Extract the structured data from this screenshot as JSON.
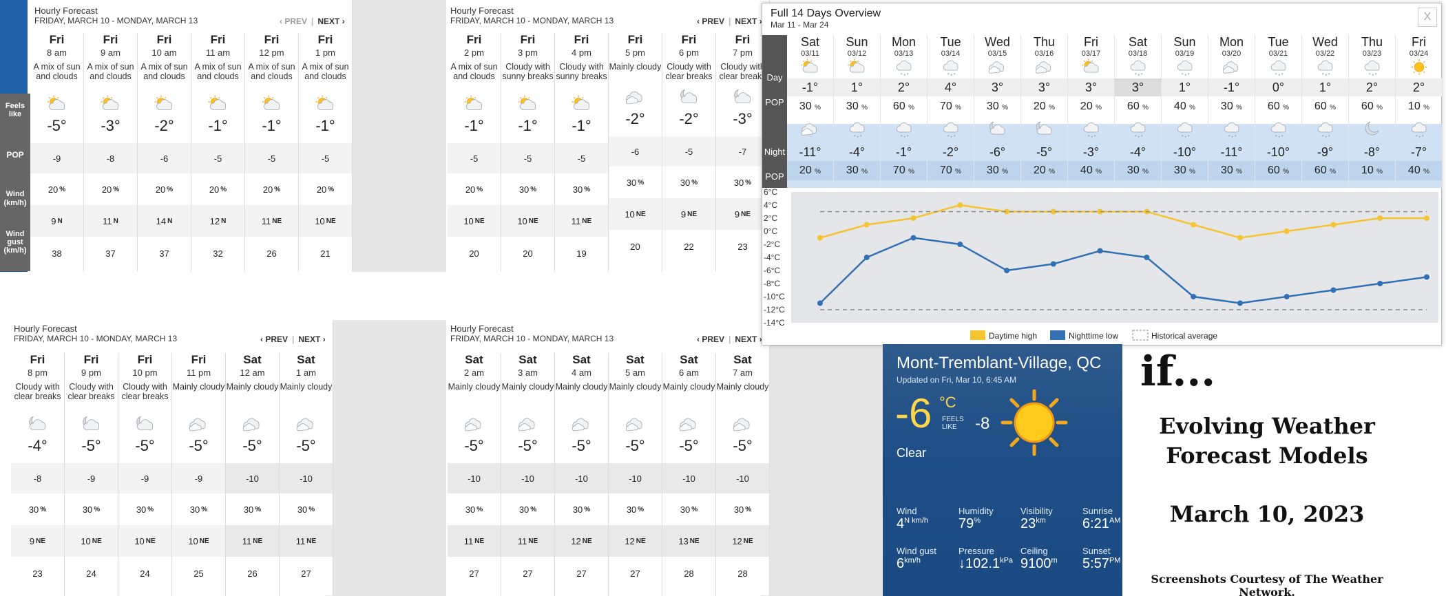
{
  "hourly_header": {
    "title": "Hourly Forecast",
    "range": "FRIDAY, MARCH 10 - MONDAY, MARCH 13",
    "prev": "‹ PREV",
    "next": "NEXT ›"
  },
  "row_labels": {
    "feels": "Feels like",
    "pop": "POP",
    "wind": "Wind (km/h)",
    "gust": "Wind gust (km/h)"
  },
  "panels": [
    {
      "cols": [
        {
          "day": "Fri",
          "time": "8 am",
          "cond": "A mix of sun and clouds",
          "icon": "sun-cloud-icon",
          "temp": "-5°",
          "feels": "-9",
          "pop": "20",
          "wind": "9",
          "dir": "N",
          "gust": "38"
        },
        {
          "day": "Fri",
          "time": "9 am",
          "cond": "A mix of sun and clouds",
          "icon": "sun-cloud-icon",
          "temp": "-3°",
          "feels": "-8",
          "pop": "20",
          "wind": "11",
          "dir": "N",
          "gust": "37"
        },
        {
          "day": "Fri",
          "time": "10 am",
          "cond": "A mix of sun and clouds",
          "icon": "sun-cloud-icon",
          "temp": "-2°",
          "feels": "-6",
          "pop": "20",
          "wind": "14",
          "dir": "N",
          "gust": "37"
        },
        {
          "day": "Fri",
          "time": "11 am",
          "cond": "A mix of sun and clouds",
          "icon": "sun-cloud-icon",
          "temp": "-1°",
          "feels": "-5",
          "pop": "20",
          "wind": "12",
          "dir": "N",
          "gust": "32"
        },
        {
          "day": "Fri",
          "time": "12 pm",
          "cond": "A mix of sun and clouds",
          "icon": "sun-cloud-icon",
          "temp": "-1°",
          "feels": "-5",
          "pop": "20",
          "wind": "11",
          "dir": "NE",
          "gust": "26"
        },
        {
          "day": "Fri",
          "time": "1 pm",
          "cond": "A mix of sun and clouds",
          "icon": "sun-cloud-icon",
          "temp": "-1°",
          "feels": "-5",
          "pop": "20",
          "wind": "10",
          "dir": "NE",
          "gust": "21"
        }
      ]
    },
    {
      "cols": [
        {
          "day": "Fri",
          "time": "2 pm",
          "cond": "A mix of sun and clouds",
          "icon": "sun-cloud-icon",
          "temp": "-1°",
          "feels": "-5",
          "pop": "20",
          "wind": "10",
          "dir": "NE",
          "gust": "20"
        },
        {
          "day": "Fri",
          "time": "3 pm",
          "cond": "Cloudy with sunny breaks",
          "icon": "sun-cloud-icon",
          "temp": "-1°",
          "feels": "-5",
          "pop": "30",
          "wind": "10",
          "dir": "NE",
          "gust": "20"
        },
        {
          "day": "Fri",
          "time": "4 pm",
          "cond": "Cloudy with sunny breaks",
          "icon": "sun-cloud-icon",
          "temp": "-1°",
          "feels": "-5",
          "pop": "30",
          "wind": "11",
          "dir": "NE",
          "gust": "19"
        },
        {
          "day": "Fri",
          "time": "5 pm",
          "cond": "Mainly cloudy",
          "icon": "cloud-icon",
          "temp": "-2°",
          "feels": "-6",
          "pop": "30",
          "wind": "10",
          "dir": "NE",
          "gust": "20"
        },
        {
          "day": "Fri",
          "time": "6 pm",
          "cond": "Cloudy with clear breaks",
          "icon": "moon-cloud-icon",
          "temp": "-2°",
          "feels": "-5",
          "pop": "30",
          "wind": "9",
          "dir": "NE",
          "gust": "22"
        },
        {
          "day": "Fri",
          "time": "7 pm",
          "cond": "Cloudy with clear breaks",
          "icon": "moon-cloud-icon",
          "temp": "-3°",
          "feels": "-7",
          "pop": "30",
          "wind": "9",
          "dir": "NE",
          "gust": "23"
        }
      ]
    },
    {
      "cols": [
        {
          "day": "Fri",
          "time": "8 pm",
          "cond": "Cloudy with clear breaks",
          "icon": "moon-cloud-icon",
          "temp": "-4°",
          "feels": "-8",
          "pop": "30",
          "wind": "9",
          "dir": "NE",
          "gust": "23"
        },
        {
          "day": "Fri",
          "time": "9 pm",
          "cond": "Cloudy with clear breaks",
          "icon": "moon-cloud-icon",
          "temp": "-5°",
          "feels": "-9",
          "pop": "30",
          "wind": "10",
          "dir": "NE",
          "gust": "24"
        },
        {
          "day": "Fri",
          "time": "10 pm",
          "cond": "Cloudy with clear breaks",
          "icon": "moon-cloud-icon",
          "temp": "-5°",
          "feels": "-9",
          "pop": "30",
          "wind": "10",
          "dir": "NE",
          "gust": "24"
        },
        {
          "day": "Fri",
          "time": "11 pm",
          "cond": "Mainly cloudy",
          "icon": "cloud-icon",
          "temp": "-5°",
          "feels": "-9",
          "pop": "30",
          "wind": "10",
          "dir": "NE",
          "gust": "25"
        },
        {
          "day": "Sat",
          "time": "12 am",
          "cond": "Mainly cloudy",
          "icon": "cloud-icon",
          "temp": "-5°",
          "feels": "-10",
          "pop": "30",
          "wind": "11",
          "dir": "NE",
          "gust": "26"
        },
        {
          "day": "Sat",
          "time": "1 am",
          "cond": "Mainly cloudy",
          "icon": "cloud-icon",
          "temp": "-5°",
          "feels": "-10",
          "pop": "30",
          "wind": "11",
          "dir": "NE",
          "gust": "27"
        }
      ]
    },
    {
      "cols": [
        {
          "day": "Sat",
          "time": "2 am",
          "cond": "Mainly cloudy",
          "icon": "cloud-icon",
          "temp": "-5°",
          "feels": "-10",
          "pop": "30",
          "wind": "11",
          "dir": "NE",
          "gust": "27"
        },
        {
          "day": "Sat",
          "time": "3 am",
          "cond": "Mainly cloudy",
          "icon": "cloud-icon",
          "temp": "-5°",
          "feels": "-10",
          "pop": "30",
          "wind": "11",
          "dir": "NE",
          "gust": "27"
        },
        {
          "day": "Sat",
          "time": "4 am",
          "cond": "Mainly cloudy",
          "icon": "cloud-icon",
          "temp": "-5°",
          "feels": "-10",
          "pop": "30",
          "wind": "12",
          "dir": "NE",
          "gust": "27"
        },
        {
          "day": "Sat",
          "time": "5 am",
          "cond": "Mainly cloudy",
          "icon": "cloud-icon",
          "temp": "-5°",
          "feels": "-10",
          "pop": "30",
          "wind": "12",
          "dir": "NE",
          "gust": "27"
        },
        {
          "day": "Sat",
          "time": "6 am",
          "cond": "Mainly cloudy",
          "icon": "cloud-icon",
          "temp": "-5°",
          "feels": "-10",
          "pop": "30",
          "wind": "13",
          "dir": "NE",
          "gust": "28"
        },
        {
          "day": "Sat",
          "time": "7 am",
          "cond": "Mainly cloudy",
          "icon": "cloud-icon",
          "temp": "-5°",
          "feels": "-10",
          "pop": "30",
          "wind": "12",
          "dir": "NE",
          "gust": "28"
        }
      ]
    }
  ],
  "overview": {
    "title": "Full 14 Days Overview",
    "range": "Mar 11 - Mar 24",
    "close": "X",
    "labels": {
      "day": "Day",
      "pop": "POP",
      "night": "Night"
    },
    "days": [
      {
        "dn": "Sat",
        "dd": "03/11",
        "icon": "sun-cloud-icon",
        "hi": "-1°",
        "dpop": "30",
        "nicon": "cloud-icon",
        "lo": "-11°",
        "npop": "20"
      },
      {
        "dn": "Sun",
        "dd": "03/12",
        "icon": "sun-cloud-icon",
        "hi": "1°",
        "dpop": "30",
        "nicon": "snow-cloud-icon",
        "lo": "-4°",
        "npop": "30"
      },
      {
        "dn": "Mon",
        "dd": "03/13",
        "icon": "snow-cloud-icon",
        "hi": "2°",
        "dpop": "60",
        "nicon": "snow-cloud-icon",
        "lo": "-1°",
        "npop": "70"
      },
      {
        "dn": "Tue",
        "dd": "03/14",
        "icon": "snow-cloud-icon",
        "hi": "4°",
        "dpop": "70",
        "nicon": "snow-cloud-icon",
        "lo": "-2°",
        "npop": "70"
      },
      {
        "dn": "Wed",
        "dd": "03/15",
        "icon": "cloud-icon",
        "hi": "3°",
        "dpop": "30",
        "nicon": "moon-cloud-icon",
        "lo": "-6°",
        "npop": "30"
      },
      {
        "dn": "Thu",
        "dd": "03/16",
        "icon": "cloud-icon",
        "hi": "3°",
        "dpop": "20",
        "nicon": "moon-cloud-icon",
        "lo": "-5°",
        "npop": "20"
      },
      {
        "dn": "Fri",
        "dd": "03/17",
        "icon": "sun-cloud-icon",
        "hi": "3°",
        "dpop": "20",
        "nicon": "snow-cloud-icon",
        "lo": "-3°",
        "npop": "40"
      },
      {
        "dn": "Sat",
        "dd": "03/18",
        "icon": "snow-cloud-icon",
        "hi": "3°",
        "dpop": "60",
        "nicon": "snow-cloud-icon",
        "lo": "-4°",
        "npop": "30"
      },
      {
        "dn": "Sun",
        "dd": "03/19",
        "icon": "snow-cloud-icon",
        "hi": "1°",
        "dpop": "40",
        "nicon": "snow-cloud-icon",
        "lo": "-10°",
        "npop": "30"
      },
      {
        "dn": "Mon",
        "dd": "03/20",
        "icon": "cloud-icon",
        "hi": "-1°",
        "dpop": "30",
        "nicon": "snow-cloud-icon",
        "lo": "-11°",
        "npop": "30"
      },
      {
        "dn": "Tue",
        "dd": "03/21",
        "icon": "snow-cloud-icon",
        "hi": "0°",
        "dpop": "60",
        "nicon": "snow-cloud-icon",
        "lo": "-10°",
        "npop": "60"
      },
      {
        "dn": "Wed",
        "dd": "03/22",
        "icon": "snow-cloud-icon",
        "hi": "1°",
        "dpop": "60",
        "nicon": "snow-cloud-icon",
        "lo": "-9°",
        "npop": "60"
      },
      {
        "dn": "Thu",
        "dd": "03/23",
        "icon": "snow-cloud-icon",
        "hi": "2°",
        "dpop": "60",
        "nicon": "moon-icon",
        "lo": "-8°",
        "npop": "10"
      },
      {
        "dn": "Fri",
        "dd": "03/24",
        "icon": "sun-icon",
        "hi": "2°",
        "dpop": "10",
        "nicon": "snow-cloud-icon",
        "lo": "-7°",
        "npop": "40"
      }
    ]
  },
  "chart_data": {
    "type": "line",
    "x": [
      "03/11",
      "03/12",
      "03/13",
      "03/14",
      "03/15",
      "03/16",
      "03/17",
      "03/18",
      "03/19",
      "03/20",
      "03/21",
      "03/22",
      "03/23",
      "03/24"
    ],
    "series": [
      {
        "name": "Daytime high",
        "color": "#f5c431",
        "values": [
          -1,
          1,
          2,
          4,
          3,
          3,
          3,
          3,
          1,
          -1,
          0,
          1,
          2,
          2
        ]
      },
      {
        "name": "Nighttime low",
        "color": "#3370b3",
        "values": [
          -11,
          -4,
          -1,
          -2,
          -6,
          -5,
          -3,
          -4,
          -10,
          -11,
          -10,
          -9,
          -8,
          -7
        ]
      },
      {
        "name": "Historical average",
        "color": "#888888",
        "dashed": true,
        "values": [
          3,
          3,
          3,
          3,
          3,
          3,
          3,
          3,
          3,
          3,
          3,
          3,
          3,
          3
        ]
      },
      {
        "name": "",
        "color": "#888888",
        "dashed": true,
        "values": [
          -12,
          -12,
          -12,
          -12,
          -12,
          -12,
          -12,
          -12,
          -12,
          -12,
          -12,
          -12,
          -12,
          -12
        ]
      }
    ],
    "ylim": [
      -14,
      6
    ],
    "yticks": [
      "6°C",
      "4°C",
      "2°C",
      "0°C",
      "-2°C",
      "-4°C",
      "-6°C",
      "-8°C",
      "-10°C",
      "-12°C",
      "-14°C"
    ],
    "legend": {
      "placement": "bottom",
      "items": [
        "Daytime high",
        "Nighttime low",
        "Historical average"
      ]
    }
  },
  "current": {
    "location": "Mont-Tremblant-Village, QC",
    "updated": "Updated on Fri, Mar 10, 6:45 AM",
    "temp": "-6",
    "unit": "°C",
    "feels_label": "FEELS LIKE",
    "feels": "-8",
    "condition": "Clear",
    "stats": [
      {
        "label": "Wind",
        "value": "4",
        "sup": "N km/h"
      },
      {
        "label": "Humidity",
        "value": "79",
        "sup": "%"
      },
      {
        "label": "Visibility",
        "value": "23",
        "sup": "km"
      },
      {
        "label": "Sunrise",
        "value": "6:21",
        "sup": "AM"
      },
      {
        "label": "Wind gust",
        "value": "6",
        "sup": "km/h"
      },
      {
        "label": "Pressure",
        "value": "↓102.1",
        "sup": "kPa"
      },
      {
        "label": "Ceiling",
        "value": "9100",
        "sup": "m"
      },
      {
        "label": "Sunset",
        "value": "5:57",
        "sup": "PM"
      }
    ]
  },
  "caption": {
    "if": "if...",
    "line1": "Evolving Weather",
    "line2": "Forecast Models",
    "date": "March 10, 2023",
    "credit": "Screenshots Courtesy of The Weather Network."
  }
}
